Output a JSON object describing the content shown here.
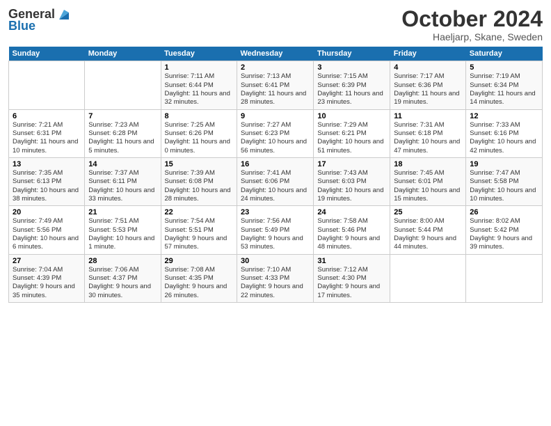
{
  "logo": {
    "general": "General",
    "blue": "Blue"
  },
  "title": "October 2024",
  "subtitle": "Haeljarp, Skane, Sweden",
  "headers": [
    "Sunday",
    "Monday",
    "Tuesday",
    "Wednesday",
    "Thursday",
    "Friday",
    "Saturday"
  ],
  "rows": [
    [
      {
        "date": "",
        "info": ""
      },
      {
        "date": "",
        "info": ""
      },
      {
        "date": "1",
        "info": "Sunrise: 7:11 AM\nSunset: 6:44 PM\nDaylight: 11 hours\nand 32 minutes."
      },
      {
        "date": "2",
        "info": "Sunrise: 7:13 AM\nSunset: 6:41 PM\nDaylight: 11 hours\nand 28 minutes."
      },
      {
        "date": "3",
        "info": "Sunrise: 7:15 AM\nSunset: 6:39 PM\nDaylight: 11 hours\nand 23 minutes."
      },
      {
        "date": "4",
        "info": "Sunrise: 7:17 AM\nSunset: 6:36 PM\nDaylight: 11 hours\nand 19 minutes."
      },
      {
        "date": "5",
        "info": "Sunrise: 7:19 AM\nSunset: 6:34 PM\nDaylight: 11 hours\nand 14 minutes."
      }
    ],
    [
      {
        "date": "6",
        "info": "Sunrise: 7:21 AM\nSunset: 6:31 PM\nDaylight: 11 hours\nand 10 minutes."
      },
      {
        "date": "7",
        "info": "Sunrise: 7:23 AM\nSunset: 6:28 PM\nDaylight: 11 hours\nand 5 minutes."
      },
      {
        "date": "8",
        "info": "Sunrise: 7:25 AM\nSunset: 6:26 PM\nDaylight: 11 hours\nand 0 minutes."
      },
      {
        "date": "9",
        "info": "Sunrise: 7:27 AM\nSunset: 6:23 PM\nDaylight: 10 hours\nand 56 minutes."
      },
      {
        "date": "10",
        "info": "Sunrise: 7:29 AM\nSunset: 6:21 PM\nDaylight: 10 hours\nand 51 minutes."
      },
      {
        "date": "11",
        "info": "Sunrise: 7:31 AM\nSunset: 6:18 PM\nDaylight: 10 hours\nand 47 minutes."
      },
      {
        "date": "12",
        "info": "Sunrise: 7:33 AM\nSunset: 6:16 PM\nDaylight: 10 hours\nand 42 minutes."
      }
    ],
    [
      {
        "date": "13",
        "info": "Sunrise: 7:35 AM\nSunset: 6:13 PM\nDaylight: 10 hours\nand 38 minutes."
      },
      {
        "date": "14",
        "info": "Sunrise: 7:37 AM\nSunset: 6:11 PM\nDaylight: 10 hours\nand 33 minutes."
      },
      {
        "date": "15",
        "info": "Sunrise: 7:39 AM\nSunset: 6:08 PM\nDaylight: 10 hours\nand 28 minutes."
      },
      {
        "date": "16",
        "info": "Sunrise: 7:41 AM\nSunset: 6:06 PM\nDaylight: 10 hours\nand 24 minutes."
      },
      {
        "date": "17",
        "info": "Sunrise: 7:43 AM\nSunset: 6:03 PM\nDaylight: 10 hours\nand 19 minutes."
      },
      {
        "date": "18",
        "info": "Sunrise: 7:45 AM\nSunset: 6:01 PM\nDaylight: 10 hours\nand 15 minutes."
      },
      {
        "date": "19",
        "info": "Sunrise: 7:47 AM\nSunset: 5:58 PM\nDaylight: 10 hours\nand 10 minutes."
      }
    ],
    [
      {
        "date": "20",
        "info": "Sunrise: 7:49 AM\nSunset: 5:56 PM\nDaylight: 10 hours\nand 6 minutes."
      },
      {
        "date": "21",
        "info": "Sunrise: 7:51 AM\nSunset: 5:53 PM\nDaylight: 10 hours\nand 1 minute."
      },
      {
        "date": "22",
        "info": "Sunrise: 7:54 AM\nSunset: 5:51 PM\nDaylight: 9 hours\nand 57 minutes."
      },
      {
        "date": "23",
        "info": "Sunrise: 7:56 AM\nSunset: 5:49 PM\nDaylight: 9 hours\nand 53 minutes."
      },
      {
        "date": "24",
        "info": "Sunrise: 7:58 AM\nSunset: 5:46 PM\nDaylight: 9 hours\nand 48 minutes."
      },
      {
        "date": "25",
        "info": "Sunrise: 8:00 AM\nSunset: 5:44 PM\nDaylight: 9 hours\nand 44 minutes."
      },
      {
        "date": "26",
        "info": "Sunrise: 8:02 AM\nSunset: 5:42 PM\nDaylight: 9 hours\nand 39 minutes."
      }
    ],
    [
      {
        "date": "27",
        "info": "Sunrise: 7:04 AM\nSunset: 4:39 PM\nDaylight: 9 hours\nand 35 minutes."
      },
      {
        "date": "28",
        "info": "Sunrise: 7:06 AM\nSunset: 4:37 PM\nDaylight: 9 hours\nand 30 minutes."
      },
      {
        "date": "29",
        "info": "Sunrise: 7:08 AM\nSunset: 4:35 PM\nDaylight: 9 hours\nand 26 minutes."
      },
      {
        "date": "30",
        "info": "Sunrise: 7:10 AM\nSunset: 4:33 PM\nDaylight: 9 hours\nand 22 minutes."
      },
      {
        "date": "31",
        "info": "Sunrise: 7:12 AM\nSunset: 4:30 PM\nDaylight: 9 hours\nand 17 minutes."
      },
      {
        "date": "",
        "info": ""
      },
      {
        "date": "",
        "info": ""
      }
    ]
  ]
}
